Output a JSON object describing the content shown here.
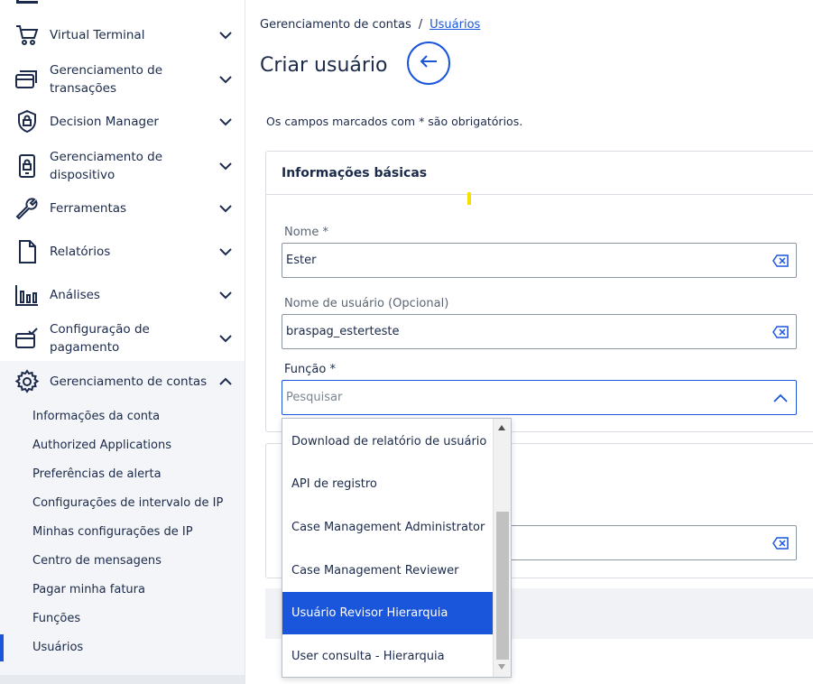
{
  "sidebar": {
    "items": [
      {
        "label": "Virtual Terminal",
        "icon": "cart-icon",
        "expanded": false
      },
      {
        "label": "Gerenciamento de transações",
        "icon": "card-stack-icon",
        "expanded": false
      },
      {
        "label": "Decision Manager",
        "icon": "shield-lock-icon",
        "expanded": false
      },
      {
        "label": "Gerenciamento de dispositivo",
        "icon": "device-lock-icon",
        "expanded": false
      },
      {
        "label": "Ferramentas",
        "icon": "wrench-icon",
        "expanded": false
      },
      {
        "label": "Relatórios",
        "icon": "document-icon",
        "expanded": false
      },
      {
        "label": "Análises",
        "icon": "bar-chart-icon",
        "expanded": false
      },
      {
        "label": "Configuração de pagamento",
        "icon": "payment-config-icon",
        "expanded": false
      },
      {
        "label": "Gerenciamento de contas",
        "icon": "gear-icon",
        "expanded": true
      }
    ],
    "sub_items": [
      {
        "label": "Informações da conta"
      },
      {
        "label": "Authorized Applications"
      },
      {
        "label": "Preferências de alerta"
      },
      {
        "label": "Configurações de intervalo de IP"
      },
      {
        "label": "Minhas configurações de IP"
      },
      {
        "label": "Centro de mensagens"
      },
      {
        "label": "Pagar minha fatura"
      },
      {
        "label": "Funções"
      },
      {
        "label": "Usuários",
        "active": true
      }
    ]
  },
  "breadcrumb": {
    "parent": "Gerenciamento de contas",
    "separator": "/",
    "current": "Usuários"
  },
  "page": {
    "title": "Criar usuário",
    "required_note": "Os campos marcados com * são obrigatórios."
  },
  "basic_info": {
    "title": "Informações básicas",
    "name": {
      "label": "Nome *",
      "value": "Ester"
    },
    "username": {
      "label": "Nome de usuário (Opcional)",
      "value": "braspag_esterteste"
    },
    "role": {
      "label": "Função *",
      "placeholder": "Pesquisar"
    }
  },
  "role_dropdown": {
    "options": [
      {
        "label": "Download de relatório de usuário",
        "selected": false
      },
      {
        "label": "API de registro",
        "selected": false
      },
      {
        "label": "Case Management Administrator",
        "selected": false
      },
      {
        "label": "Case Management Reviewer",
        "selected": false
      },
      {
        "label": "Usuário Revisor Hierarquia",
        "selected": true
      },
      {
        "label": "User consulta - Hierarquia",
        "selected": false
      }
    ]
  },
  "colors": {
    "accent": "#1a56db",
    "nav_text": "#1b2a4a",
    "highlight_mark": "#f5e000"
  }
}
